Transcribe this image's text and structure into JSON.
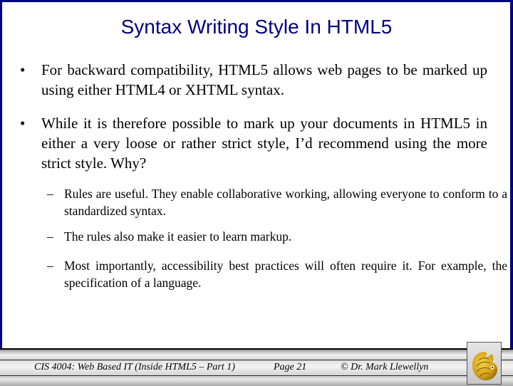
{
  "slide": {
    "title": "Syntax Writing Style In HTML5",
    "bullets": [
      {
        "marker": "•",
        "text": "For backward compatibility, HTML5 allows web pages to be marked up using either HTML4 or XHTML syntax."
      },
      {
        "marker": "•",
        "text": "While it is therefore possible to mark up your documents in HTML5 in either a very loose or rather strict style, I’d recommend using the more strict style.  Why?"
      }
    ],
    "sub_bullets": [
      {
        "marker": "–",
        "text": "Rules are useful.  They enable collaborative working, allowing everyone to conform to a standardized syntax."
      },
      {
        "marker": "–",
        "text": "The rules also make it easier to learn markup."
      },
      {
        "marker": "–",
        "text": "Most importantly, accessibility best practices will often require it.  For example, the specification of a language."
      }
    ]
  },
  "footer": {
    "course": "CIS 4004: Web Based IT (Inside HTML5 – Part 1)",
    "page": "Page 21",
    "author": "© Dr. Mark Llewellyn",
    "logo_icon": "pegasus-logo-icon"
  },
  "colors": {
    "border": "#000080",
    "title": "#000080",
    "logo_gold": "#d4a017"
  }
}
